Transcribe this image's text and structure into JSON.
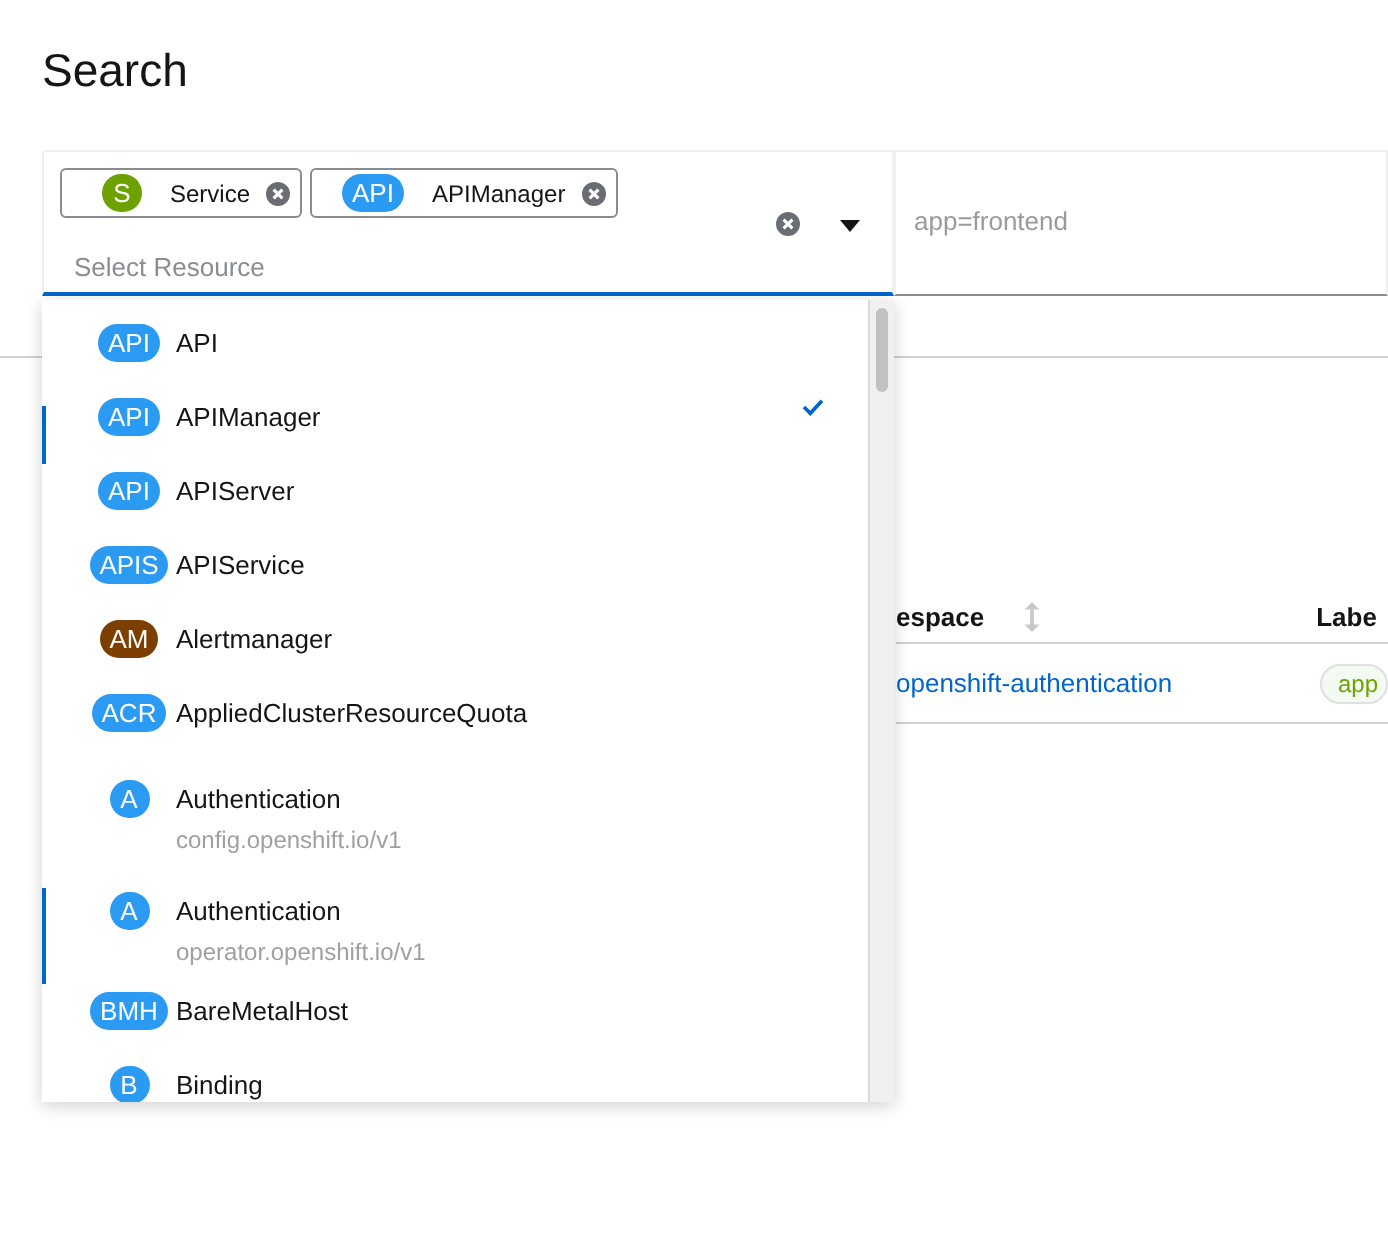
{
  "page_title": "Search",
  "resource_filter": {
    "chips": [
      {
        "badge": "S",
        "label": "Service",
        "color": "#6ca100"
      },
      {
        "badge": "API",
        "label": "APIManager",
        "color": "#2b9af3"
      }
    ],
    "placeholder": "Select Resource"
  },
  "label_filter": {
    "placeholder": "app=frontend"
  },
  "dropdown": {
    "items": [
      {
        "badge": "API",
        "label": "API",
        "color": "#2b9af3",
        "selected": false,
        "focused": false
      },
      {
        "badge": "API",
        "label": "APIManager",
        "color": "#2b9af3",
        "selected": true,
        "focused": true
      },
      {
        "badge": "API",
        "label": "APIServer",
        "color": "#2b9af3",
        "selected": false,
        "focused": false
      },
      {
        "badge": "APIS",
        "label": "APIService",
        "color": "#2b9af3",
        "selected": false,
        "focused": false
      },
      {
        "badge": "AM",
        "label": "Alertmanager",
        "color": "#7d3f00",
        "selected": false,
        "focused": false
      },
      {
        "badge": "ACR",
        "label": "AppliedClusterResourceQuota",
        "color": "#2b9af3",
        "selected": false,
        "focused": false
      },
      {
        "badge": "A",
        "label": "Authentication",
        "group": "config.openshift.io/v1",
        "color": "#2b9af3",
        "selected": false,
        "focused": false
      },
      {
        "badge": "A",
        "label": "Authentication",
        "group": "operator.openshift.io/v1",
        "color": "#2b9af3",
        "selected": false,
        "focused": true
      },
      {
        "badge": "BMH",
        "label": "BareMetalHost",
        "color": "#2b9af3",
        "selected": false,
        "focused": false
      },
      {
        "badge": "B",
        "label": "Binding",
        "color": "#2b9af3",
        "selected": false,
        "focused": false
      }
    ]
  },
  "table": {
    "columns": [
      "espace",
      "Labe"
    ],
    "rows": [
      {
        "namespace": "openshift-authentication",
        "label": "app"
      }
    ]
  }
}
